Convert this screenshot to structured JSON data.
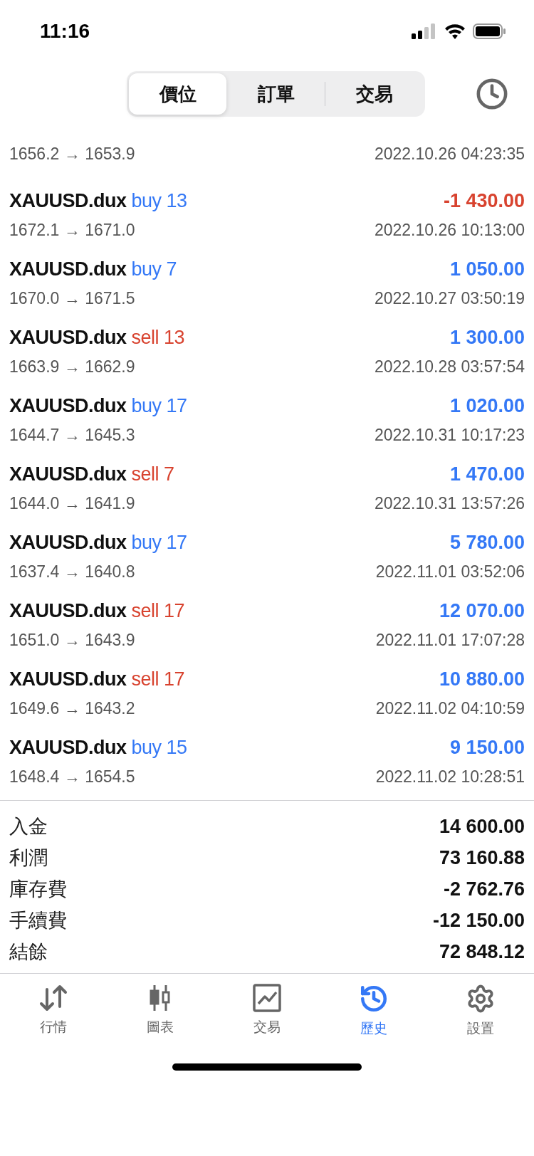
{
  "status_bar": {
    "time": "11:16"
  },
  "segments": [
    {
      "label": "價位",
      "selected": true
    },
    {
      "label": "訂單",
      "selected": false
    },
    {
      "label": "交易",
      "selected": false
    }
  ],
  "deals": [
    {
      "prices": "1656.2 → 1653.9",
      "time": "2022.10.26 04:23:35"
    },
    {
      "symbol": "XAUUSD.dux",
      "type": "buy",
      "volume": "13",
      "profit": "-1 430.00",
      "loss": true,
      "prices": "1672.1 → 1671.0",
      "time": "2022.10.26 10:13:00"
    },
    {
      "symbol": "XAUUSD.dux",
      "type": "buy",
      "volume": "7",
      "profit": "1 050.00",
      "loss": false,
      "prices": "1670.0 → 1671.5",
      "time": "2022.10.27 03:50:19"
    },
    {
      "symbol": "XAUUSD.dux",
      "type": "sell",
      "volume": "13",
      "profit": "1 300.00",
      "loss": false,
      "prices": "1663.9 → 1662.9",
      "time": "2022.10.28 03:57:54"
    },
    {
      "symbol": "XAUUSD.dux",
      "type": "buy",
      "volume": "17",
      "profit": "1 020.00",
      "loss": false,
      "prices": "1644.7 → 1645.3",
      "time": "2022.10.31 10:17:23"
    },
    {
      "symbol": "XAUUSD.dux",
      "type": "sell",
      "volume": "7",
      "profit": "1 470.00",
      "loss": false,
      "prices": "1644.0 → 1641.9",
      "time": "2022.10.31 13:57:26"
    },
    {
      "symbol": "XAUUSD.dux",
      "type": "buy",
      "volume": "17",
      "profit": "5 780.00",
      "loss": false,
      "prices": "1637.4 → 1640.8",
      "time": "2022.11.01 03:52:06"
    },
    {
      "symbol": "XAUUSD.dux",
      "type": "sell",
      "volume": "17",
      "profit": "12 070.00",
      "loss": false,
      "prices": "1651.0 → 1643.9",
      "time": "2022.11.01 17:07:28"
    },
    {
      "symbol": "XAUUSD.dux",
      "type": "sell",
      "volume": "17",
      "profit": "10 880.00",
      "loss": false,
      "prices": "1649.6 → 1643.2",
      "time": "2022.11.02 04:10:59"
    },
    {
      "symbol": "XAUUSD.dux",
      "type": "buy",
      "volume": "15",
      "profit": "9 150.00",
      "loss": false,
      "prices": "1648.4 → 1654.5",
      "time": "2022.11.02 10:28:51"
    }
  ],
  "summary": [
    {
      "label": "入金",
      "value": "14 600.00"
    },
    {
      "label": "利潤",
      "value": "73 160.88"
    },
    {
      "label": "庫存費",
      "value": "-2 762.76"
    },
    {
      "label": "手續費",
      "value": "-12 150.00"
    },
    {
      "label": "結餘",
      "value": "72 848.12"
    }
  ],
  "tab_bar": [
    {
      "kind": "quotes",
      "label": "行情",
      "selected": false
    },
    {
      "kind": "chart",
      "label": "圖表",
      "selected": false
    },
    {
      "kind": "trade",
      "label": "交易",
      "selected": false
    },
    {
      "kind": "history",
      "label": "歷史",
      "selected": true
    },
    {
      "kind": "settings",
      "label": "設置",
      "selected": false
    }
  ]
}
